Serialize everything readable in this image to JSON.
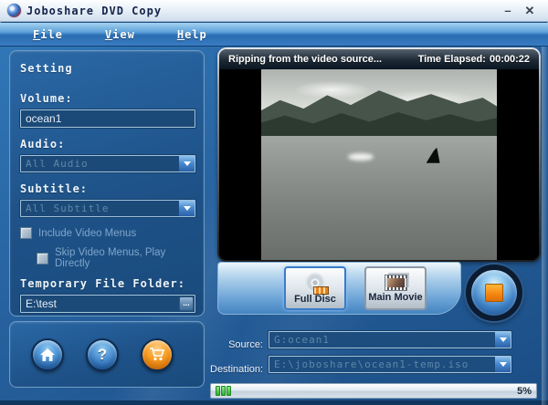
{
  "window": {
    "title": "Joboshare DVD Copy",
    "minimize_glyph": "–",
    "close_glyph": "✕"
  },
  "menu": {
    "items": [
      {
        "label": "File"
      },
      {
        "label": "View"
      },
      {
        "label": "Help"
      }
    ]
  },
  "settings": {
    "heading": "Setting",
    "volume_label": "Volume:",
    "volume_value": "ocean1",
    "audio_label": "Audio:",
    "audio_value": "All Audio",
    "subtitle_label": "Subtitle:",
    "subtitle_value": "All Subtitle",
    "include_menus_label": "Include Video Menus",
    "include_menus_checked": false,
    "skip_menus_label": "Skip Video Menus, Play Directly",
    "skip_menus_checked": false,
    "temp_folder_label": "Temporary File Folder:",
    "temp_folder_value": "E:\\test",
    "browse_label": "..."
  },
  "preview": {
    "status_text": "Ripping from the video source...",
    "time_elapsed_label": "Time Elapsed:",
    "time_elapsed_value": "00:00:22"
  },
  "modes": {
    "full_disc_label": "Full Disc",
    "main_movie_label": "Main Movie"
  },
  "output": {
    "source_label": "Source:",
    "source_value": "G:ocean1",
    "destination_label": "Destination:",
    "destination_value": "E:\\joboshare\\ocean1-temp.iso"
  },
  "progress": {
    "percent": 5,
    "percent_label": "5%"
  },
  "footer": {
    "help_glyph": "?"
  },
  "colors": {
    "accent_blue": "#2a6cb2",
    "panel_blue": "#1e5288",
    "orange": "#f08a0e",
    "progress_green": "#2fae2f",
    "disabled_text": "#5d87a8"
  }
}
